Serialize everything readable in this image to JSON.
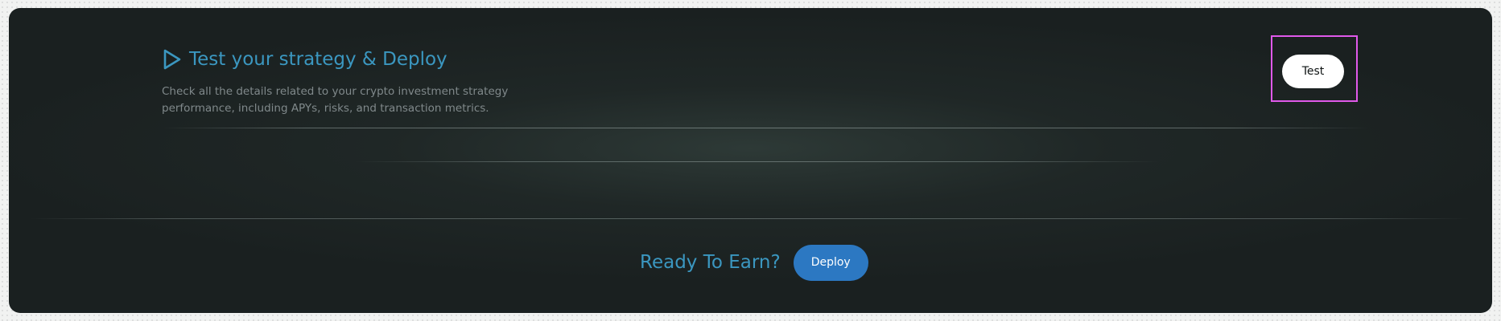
{
  "section": {
    "title": "Test your strategy & Deploy",
    "description": "Check all the details related to your crypto investment strategy performance, including APYs, risks, and transaction metrics.",
    "icon": "play-icon"
  },
  "actions": {
    "test_label": "Test"
  },
  "cta": {
    "label": "Ready To Earn?",
    "deploy_label": "Deploy"
  },
  "colors": {
    "panel_background": "#1a2020",
    "accent_blue": "#3b97c0",
    "deploy_button": "#2c78c2",
    "highlight_frame": "#e059ea",
    "description_text": "#80898b"
  }
}
